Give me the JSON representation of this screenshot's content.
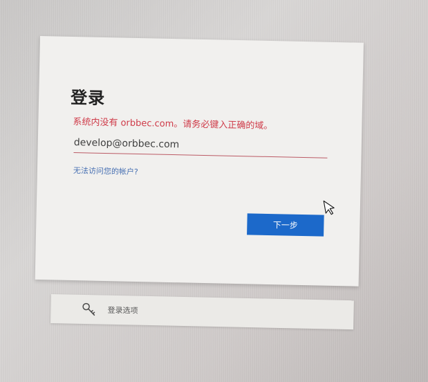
{
  "login": {
    "title": "登录",
    "error_message": "系统内没有 orbbec.com。请务必键入正确的域。",
    "email_value": "develop@orbbec.com",
    "help_link": "无法访问您的帐户?",
    "next_button": "下一步"
  },
  "signin_options": {
    "label": "登录选项",
    "icon": "key-icon"
  },
  "colors": {
    "error": "#cf3b49",
    "link": "#466fb2",
    "primary_button": "#1c69ca"
  }
}
